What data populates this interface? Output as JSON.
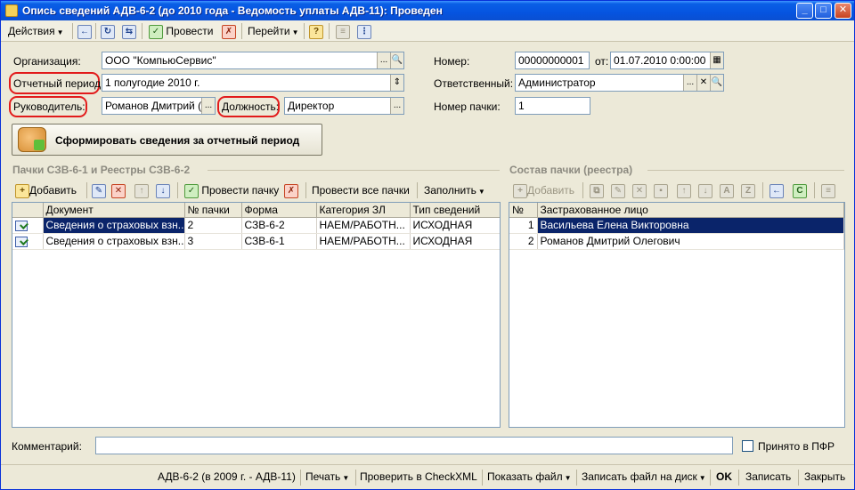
{
  "window": {
    "title": "Опись сведений АДВ-6-2 (до 2010 года - Ведомость уплаты АДВ-11): Проведен",
    "minimize": "_",
    "maximize": "□",
    "close": "✕"
  },
  "toolbar": {
    "actions": "Действия",
    "post": "Провести",
    "goto": "Перейти"
  },
  "form": {
    "org_label": "Организация:",
    "org_value": "ООО \"КомпьюСервис\"",
    "period_label": "Отчетный период:",
    "period_value": "1 полугодие 2010 г.",
    "head_label": "Руководитель:",
    "head_value": "Романов Дмитрий (",
    "position_label": "Должность:",
    "position_value": "Директор",
    "number_label": "Номер:",
    "number_value": "00000000001",
    "from_label": "от:",
    "date_value": "01.07.2010  0:00:00",
    "responsible_label": "Ответственный:",
    "responsible_value": "Администратор",
    "pack_label": "Номер пачки:",
    "pack_value": "1",
    "dots": "...",
    "generate_button": "Сформировать сведения за отчетный период"
  },
  "left_panel": {
    "title": "Пачки СЗВ-6-1 и Реестры СЗВ-6-2",
    "add": "Добавить",
    "post_pack": "Провести пачку",
    "post_all": "Провести все пачки",
    "fill": "Заполнить",
    "columns": [
      "Документ",
      "№ пачки",
      "Форма",
      "Категория ЗЛ",
      "Тип сведений"
    ],
    "rows": [
      [
        "Сведения о страховых взн...",
        "2",
        "СЗВ-6-2",
        "НАЕМ/РАБОТН...",
        "ИСХОДНАЯ"
      ],
      [
        "Сведения о страховых взн...",
        "3",
        "СЗВ-6-1",
        "НАЕМ/РАБОТН...",
        "ИСХОДНАЯ"
      ]
    ]
  },
  "right_panel": {
    "title": "Состав пачки (реестра)",
    "add": "Добавить",
    "columns": [
      "№",
      "Застрахованное лицо"
    ],
    "rows": [
      [
        "1",
        "Васильева Елена Викторовна"
      ],
      [
        "2",
        "Романов Дмитрий Олегович"
      ]
    ]
  },
  "comment": {
    "label": "Комментарий:",
    "value": "",
    "accepted_label": "Принято в ПФР"
  },
  "statusbar": {
    "form_name": "АДВ-6-2 (в 2009 г. - АДВ-11)",
    "print": "Печать",
    "check": "Проверить в CheckXML",
    "show_file": "Показать файл",
    "write_file": "Записать файл на диск",
    "ok": "OK",
    "save": "Записать",
    "close": "Закрыть"
  }
}
